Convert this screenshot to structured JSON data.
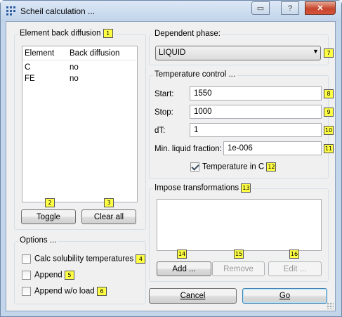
{
  "window": {
    "title": "Scheil calculation ...",
    "help_glyph": "?",
    "close_glyph": "✕",
    "restore_glyph": "▭"
  },
  "element_group": {
    "label": "Element back diffusion",
    "badge": "1",
    "columns": [
      "Element",
      "Back diffusion"
    ],
    "rows": [
      {
        "element": "C",
        "back_diffusion": "no"
      },
      {
        "element": "FE",
        "back_diffusion": "no"
      }
    ],
    "toggle": {
      "label": "Toggle",
      "badge": "2"
    },
    "clear_all": {
      "label": "Clear all",
      "badge": "3"
    }
  },
  "options_group": {
    "label": "Options ...",
    "calc_solubility": {
      "label": "Calc solubility temperatures",
      "badge": "4",
      "checked": false
    },
    "append": {
      "label": "Append",
      "badge": "5",
      "checked": false
    },
    "append_wo_load": {
      "label": "Append w/o load",
      "badge": "6",
      "checked": false
    }
  },
  "dependent_phase": {
    "label": "Dependent phase:",
    "value": "LIQUID",
    "badge": "7"
  },
  "temperature": {
    "label": "Temperature control ...",
    "start": {
      "label": "Start:",
      "value": "1550",
      "badge": "8"
    },
    "stop": {
      "label": "Stop:",
      "value": "1000",
      "badge": "9"
    },
    "dt": {
      "label": "dT:",
      "value": "1",
      "badge": "10"
    },
    "min_liquid": {
      "label": "Min. liquid fraction:",
      "value": "1e-006",
      "badge": "11"
    },
    "in_c": {
      "label": "Temperature in C",
      "badge": "12",
      "checked": true
    }
  },
  "transforms": {
    "label": "Impose transformations",
    "badge": "13",
    "add": {
      "label": "Add ...",
      "badge": "14"
    },
    "remove": {
      "label": "Remove",
      "badge": "15"
    },
    "edit": {
      "label": "Edit ...",
      "badge": "16"
    }
  },
  "footer": {
    "cancel": "Cancel",
    "go": "Go"
  },
  "colors": {
    "badge": "#ffff44",
    "window_frame": "#c3d5eb",
    "close": "#c6462d"
  }
}
